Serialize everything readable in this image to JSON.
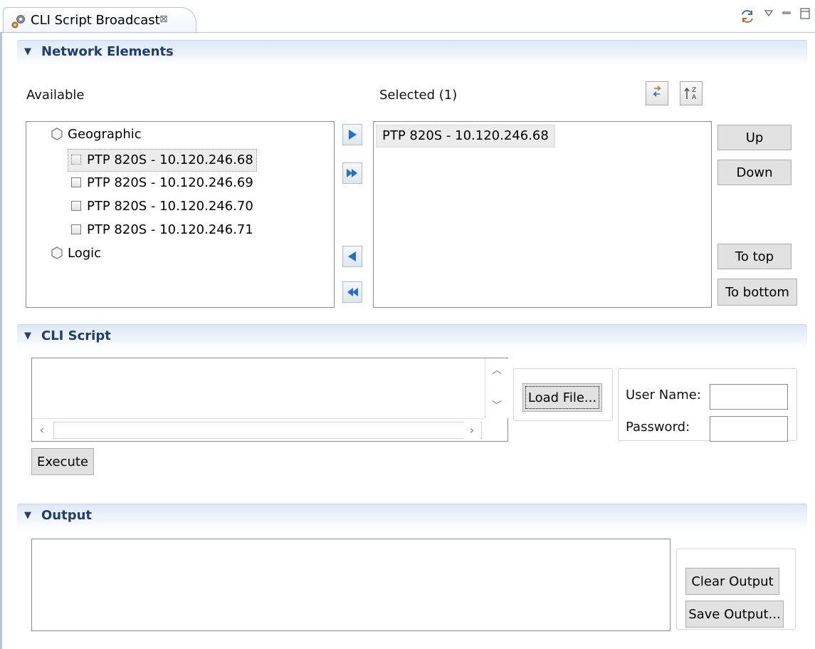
{
  "tab": {
    "title": "CLI Script Broadcast",
    "close_glyph": "⊠"
  },
  "sections": {
    "network_elements": "Network Elements",
    "cli_script": "CLI Script",
    "output": "Output"
  },
  "network": {
    "available_label": "Available",
    "selected_label": "Selected (1)",
    "tree": {
      "groups": [
        {
          "label": "Geographic",
          "children": [
            "PTP 820S - 10.120.246.68",
            "PTP 820S - 10.120.246.69",
            "PTP 820S - 10.120.246.70",
            "PTP 820S - 10.120.246.71"
          ]
        },
        {
          "label": "Logic",
          "children": []
        }
      ]
    },
    "selected_items": [
      "PTP 820S - 10.120.246.68"
    ],
    "buttons": {
      "up": "Up",
      "down": "Down",
      "to_top": "To top",
      "to_bottom": "To bottom"
    }
  },
  "cli": {
    "script_text": "",
    "load_file": "Load File...",
    "user_name_label": "User Name:",
    "user_name_value": "",
    "password_label": "Password:",
    "password_value": "",
    "execute": "Execute"
  },
  "output": {
    "text": "",
    "clear": "Clear Output",
    "save": "Save Output..."
  },
  "icons": {
    "tab": "gears-icon",
    "add": "move-right-icon",
    "add_all": "move-all-right-icon",
    "remove": "move-left-icon",
    "remove_all": "move-all-left-icon",
    "swap": "swap-icon",
    "sort": "sort-az-icon"
  },
  "colors": {
    "accent": "#1f3d6e",
    "arrow_blue": "#1f6fd6",
    "section_bg": "#dbe8f6"
  }
}
